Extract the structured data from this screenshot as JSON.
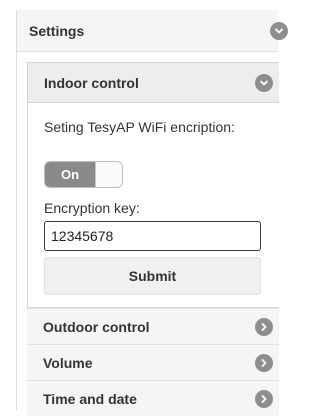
{
  "settings": {
    "title": "Settings"
  },
  "indoor": {
    "title": "Indoor control",
    "description": "Seting TesyAP WiFi encription:",
    "toggle_label": "On",
    "key_label": "Encryption key:",
    "key_value": "12345678",
    "submit_label": "Submit"
  },
  "sections": [
    {
      "label": "Outdoor control"
    },
    {
      "label": "Volume"
    },
    {
      "label": "Time and date"
    }
  ],
  "icons": {
    "expanded": "chevron-down-icon",
    "collapsed": "chevron-right-icon"
  },
  "colors": {
    "icon_bg": "#8e8e8e",
    "toggle_on": "#8a8a8a",
    "header_bg": "#f5f5f5"
  }
}
